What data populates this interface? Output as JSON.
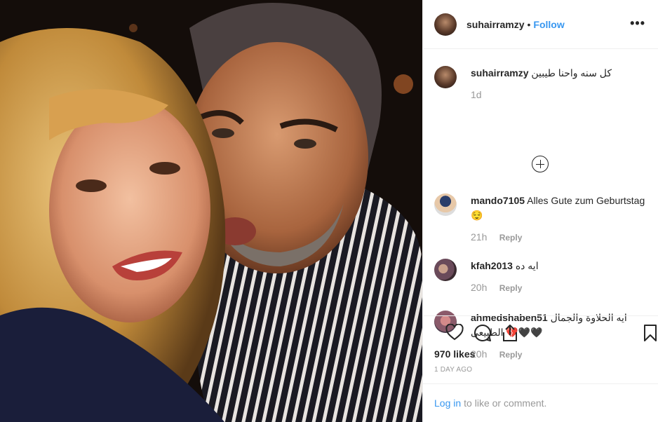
{
  "post": {
    "username": "suhairramzy",
    "separator": "•",
    "follow_label": "Follow",
    "more_label": "•••"
  },
  "caption": {
    "username": "suhairramzy",
    "text": "كل سنه واحنا طيبين",
    "time": "1d"
  },
  "comments": [
    {
      "username": "mando7105",
      "text": "Alles Gute zum Geburtstag😌",
      "time": "21h",
      "reply": "Reply"
    },
    {
      "username": "kfah2013",
      "text": "ايه ده",
      "time": "20h",
      "reply": "Reply"
    },
    {
      "username": "ahmedshaben51",
      "text": "ايه الحلاوة والجمال الطبيعى 💔🖤🖤",
      "time": "20h",
      "reply": "Reply"
    }
  ],
  "stats": {
    "likes": "970 likes",
    "date": "1 DAY AGO"
  },
  "login": {
    "link": "Log in",
    "rest": "to like or comment."
  },
  "icons": {
    "heart": "heart-icon",
    "comment": "comment-icon",
    "share": "share-icon",
    "save": "bookmark-icon",
    "load_more": "plus-circle-icon"
  },
  "colors": {
    "link": "#3897f0",
    "text": "#262626",
    "muted": "#999999",
    "border": "#efefef"
  }
}
